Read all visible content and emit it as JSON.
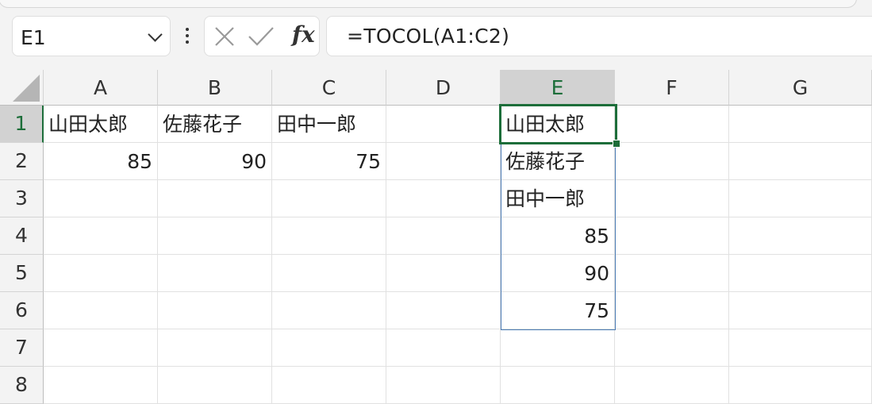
{
  "name_box": {
    "value": "E1"
  },
  "formula_bar": {
    "fx_label": "fx",
    "formula": "=TOCOL(A1:C2)"
  },
  "columns": [
    "A",
    "B",
    "C",
    "D",
    "E",
    "F",
    "G"
  ],
  "rows": [
    "1",
    "2",
    "3",
    "4",
    "5",
    "6",
    "7",
    "8"
  ],
  "cells": {
    "A1": "山田太郎",
    "B1": "佐藤花子",
    "C1": "田中一郎",
    "A2": "85",
    "B2": "90",
    "C2": "75",
    "E1": "山田太郎",
    "E2": "佐藤花子",
    "E3": "田中一郎",
    "E4": "85",
    "E5": "90",
    "E6": "75"
  },
  "selection": {
    "active_cell": "E1",
    "selected_column": "E",
    "selected_row": "1"
  },
  "colors": {
    "accent": "#1d6e3a",
    "spill_border": "#4a7bb5"
  },
  "icons": [
    "chevron-down-icon",
    "more-options-icon",
    "cancel-icon",
    "enter-icon",
    "insert-function-icon",
    "select-all-icon"
  ]
}
